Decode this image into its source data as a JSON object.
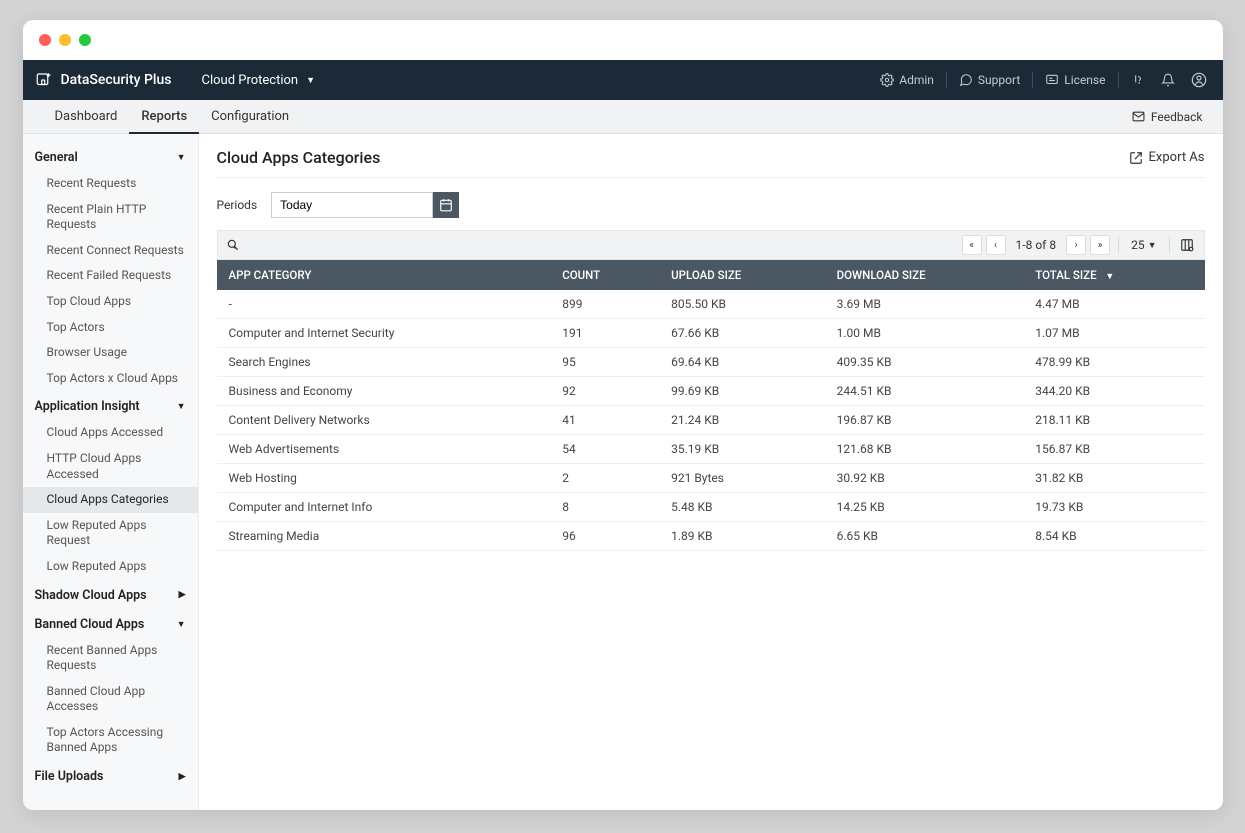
{
  "brand": "DataSecurity Plus",
  "module": "Cloud Protection",
  "top_links": {
    "admin": "Admin",
    "support": "Support",
    "license": "License"
  },
  "nav": {
    "dashboard": "Dashboard",
    "reports": "Reports",
    "configuration": "Configuration",
    "feedback": "Feedback"
  },
  "sidebar": {
    "general": {
      "label": "General",
      "items": [
        "Recent Requests",
        "Recent Plain HTTP Requests",
        "Recent Connect Requests",
        "Recent Failed Requests",
        "Top Cloud Apps",
        "Top Actors",
        "Browser Usage",
        "Top Actors x Cloud Apps"
      ]
    },
    "app_insight": {
      "label": "Application Insight",
      "items": [
        "Cloud Apps Accessed",
        "HTTP Cloud Apps Accessed",
        "Cloud Apps Categories",
        "Low Reputed Apps Request",
        "Low Reputed Apps"
      ]
    },
    "shadow": {
      "label": "Shadow Cloud Apps"
    },
    "banned": {
      "label": "Banned Cloud Apps",
      "items": [
        "Recent Banned Apps Requests",
        "Banned Cloud App Accesses",
        "Top Actors Accessing Banned Apps"
      ]
    },
    "file_uploads": {
      "label": "File Uploads"
    }
  },
  "page": {
    "title": "Cloud Apps Categories",
    "export": "Export As",
    "periods_label": "Periods",
    "period_value": "Today"
  },
  "pagination": {
    "text": "1-8 of 8",
    "page_size": "25"
  },
  "table": {
    "headers": {
      "category": "APP CATEGORY",
      "count": "COUNT",
      "upload": "UPLOAD SIZE",
      "download": "DOWNLOAD SIZE",
      "total": "TOTAL SIZE"
    },
    "rows": [
      {
        "category": "-",
        "count": "899",
        "upload": "805.50 KB",
        "download": "3.69 MB",
        "total": "4.47 MB"
      },
      {
        "category": "Computer and Internet Security",
        "count": "191",
        "upload": "67.66 KB",
        "download": "1.00 MB",
        "total": "1.07 MB"
      },
      {
        "category": "Search Engines",
        "count": "95",
        "upload": "69.64 KB",
        "download": "409.35 KB",
        "total": "478.99 KB"
      },
      {
        "category": "Business and Economy",
        "count": "92",
        "upload": "99.69 KB",
        "download": "244.51 KB",
        "total": "344.20 KB"
      },
      {
        "category": "Content Delivery Networks",
        "count": "41",
        "upload": "21.24 KB",
        "download": "196.87 KB",
        "total": "218.11 KB"
      },
      {
        "category": "Web Advertisements",
        "count": "54",
        "upload": "35.19 KB",
        "download": "121.68 KB",
        "total": "156.87 KB"
      },
      {
        "category": "Web Hosting",
        "count": "2",
        "upload": "921 Bytes",
        "download": "30.92 KB",
        "total": "31.82 KB"
      },
      {
        "category": "Computer and Internet Info",
        "count": "8",
        "upload": "5.48 KB",
        "download": "14.25 KB",
        "total": "19.73 KB"
      },
      {
        "category": "Streaming Media",
        "count": "96",
        "upload": "1.89 KB",
        "download": "6.65 KB",
        "total": "8.54 KB"
      }
    ]
  }
}
